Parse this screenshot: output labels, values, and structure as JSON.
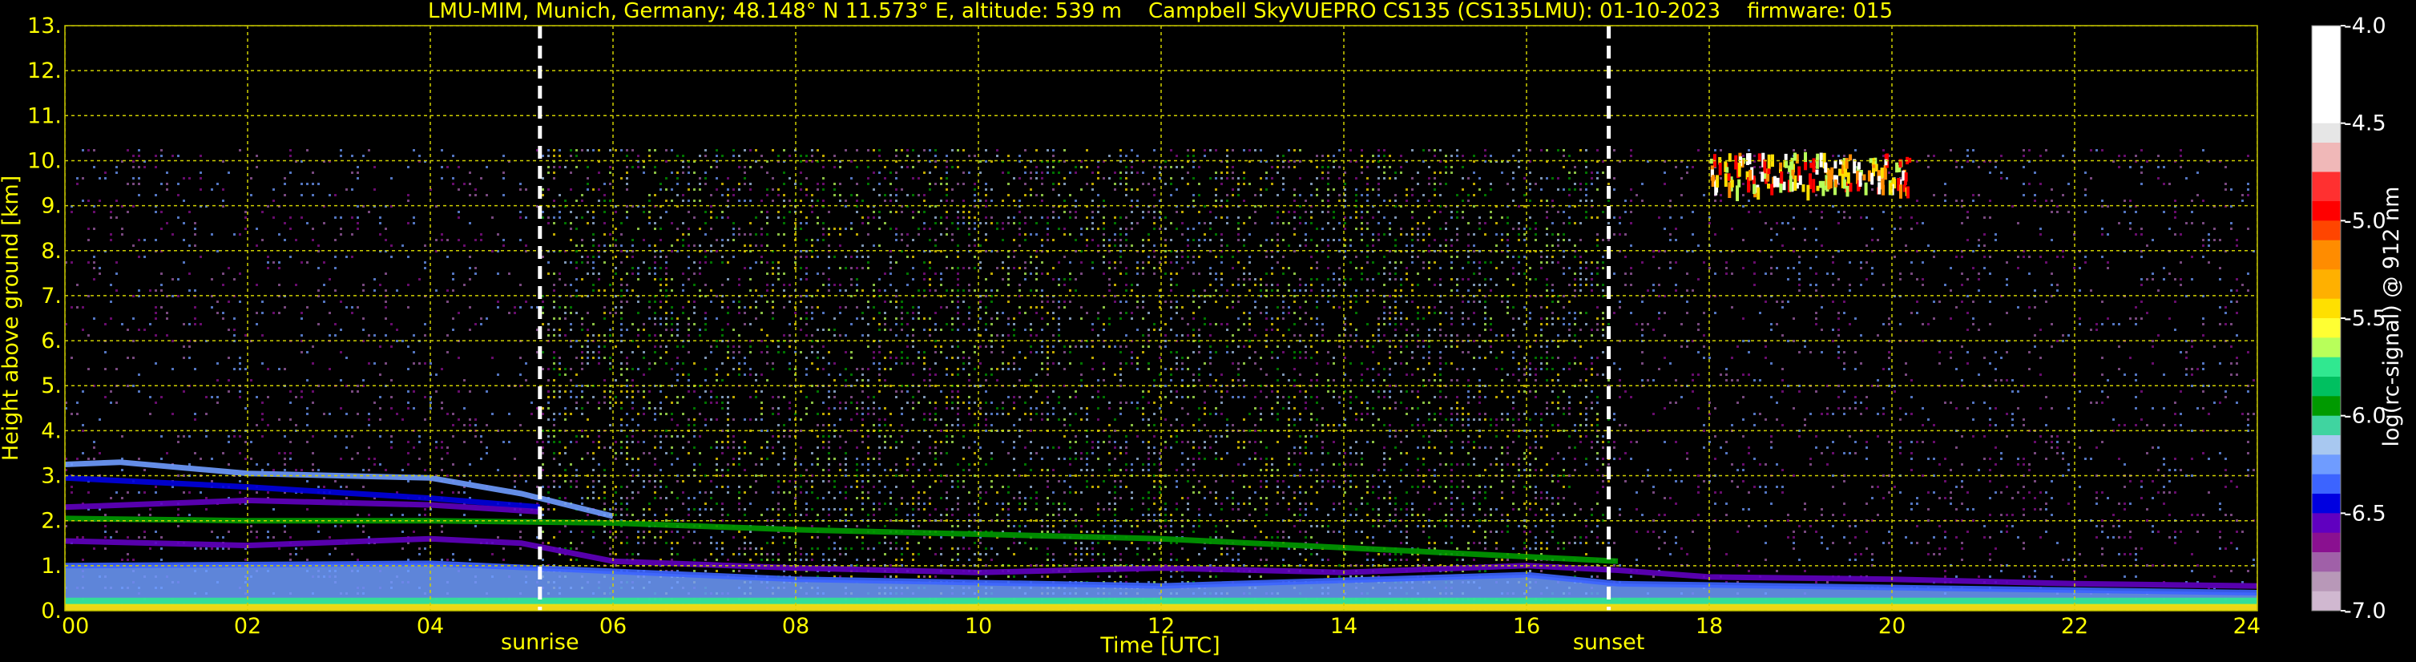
{
  "chart_data": {
    "type": "heatmap",
    "title": "LMU-MIM, Munich, Germany; 48.148° N 11.573° E, altitude: 539 m    Campbell SkyVUEPRO CS135 (CS135LMU): 01-10-2023    firmware: 015",
    "xlabel": "Time [UTC]",
    "ylabel": "Height above ground [km]",
    "xlim": [
      0,
      24
    ],
    "ylim": [
      0,
      13
    ],
    "x_ticks": [
      {
        "value": 0,
        "label": "00"
      },
      {
        "value": 2,
        "label": "02"
      },
      {
        "value": 4,
        "label": "04"
      },
      {
        "value": 6,
        "label": "06"
      },
      {
        "value": 8,
        "label": "08"
      },
      {
        "value": 10,
        "label": "10"
      },
      {
        "value": 12,
        "label": "12"
      },
      {
        "value": 14,
        "label": "14"
      },
      {
        "value": 16,
        "label": "16"
      },
      {
        "value": 18,
        "label": "18"
      },
      {
        "value": 20,
        "label": "20"
      },
      {
        "value": 22,
        "label": "22"
      },
      {
        "value": 24,
        "label": "24"
      }
    ],
    "y_ticks": [
      {
        "value": 0,
        "label": "0."
      },
      {
        "value": 1,
        "label": "1."
      },
      {
        "value": 2,
        "label": "2."
      },
      {
        "value": 3,
        "label": "3."
      },
      {
        "value": 4,
        "label": "4."
      },
      {
        "value": 5,
        "label": "5."
      },
      {
        "value": 6,
        "label": "6."
      },
      {
        "value": 7,
        "label": "7."
      },
      {
        "value": 8,
        "label": "8."
      },
      {
        "value": 9,
        "label": "9."
      },
      {
        "value": 10,
        "label": "10."
      },
      {
        "value": 11,
        "label": "11."
      },
      {
        "value": 12,
        "label": "12."
      },
      {
        "value": 13,
        "label": "13."
      }
    ],
    "grid": true,
    "annotations": [
      {
        "x": 5.2,
        "label": "sunrise"
      },
      {
        "x": 16.9,
        "label": "sunset"
      }
    ],
    "colorbar": {
      "label": "log(rc-signal) @ 912 nm",
      "range": [
        -7.0,
        -4.0
      ],
      "ticks": [
        {
          "value": -4.0,
          "label": "-4.0"
        },
        {
          "value": -4.5,
          "label": "-4.5"
        },
        {
          "value": -5.0,
          "label": "-5.0"
        },
        {
          "value": -5.5,
          "label": "-5.5"
        },
        {
          "value": -6.0,
          "label": "-6.0"
        },
        {
          "value": -6.5,
          "label": "-6.5"
        },
        {
          "value": -7.0,
          "label": "-7.0"
        }
      ],
      "levels": [
        {
          "from": -4.0,
          "to": -4.5,
          "color": "#ffffff"
        },
        {
          "from": -4.5,
          "to": -4.6,
          "color": "#e6e6e6"
        },
        {
          "from": -4.6,
          "to": -4.75,
          "color": "#f0b8b8"
        },
        {
          "from": -4.75,
          "to": -4.9,
          "color": "#ff3030"
        },
        {
          "from": -4.9,
          "to": -5.0,
          "color": "#ff0000"
        },
        {
          "from": -5.0,
          "to": -5.1,
          "color": "#ff4500"
        },
        {
          "from": -5.1,
          "to": -5.25,
          "color": "#ff8c00"
        },
        {
          "from": -5.25,
          "to": -5.4,
          "color": "#ffb000"
        },
        {
          "from": -5.4,
          "to": -5.5,
          "color": "#ffe000"
        },
        {
          "from": -5.5,
          "to": -5.6,
          "color": "#ffff33"
        },
        {
          "from": -5.6,
          "to": -5.7,
          "color": "#b8ff5a"
        },
        {
          "from": -5.7,
          "to": -5.8,
          "color": "#30e890"
        },
        {
          "from": -5.8,
          "to": -5.9,
          "color": "#00c060"
        },
        {
          "from": -5.9,
          "to": -6.0,
          "color": "#009a00"
        },
        {
          "from": -6.0,
          "to": -6.1,
          "color": "#40d4a0"
        },
        {
          "from": -6.1,
          "to": -6.2,
          "color": "#a8c8f0"
        },
        {
          "from": -6.2,
          "to": -6.3,
          "color": "#6f9cff"
        },
        {
          "from": -6.3,
          "to": -6.4,
          "color": "#3c64ff"
        },
        {
          "from": -6.4,
          "to": -6.5,
          "color": "#0000e0"
        },
        {
          "from": -6.5,
          "to": -6.6,
          "color": "#6000c0"
        },
        {
          "from": -6.6,
          "to": -6.7,
          "color": "#8a1090"
        },
        {
          "from": -6.7,
          "to": -6.8,
          "color": "#a060a8"
        },
        {
          "from": -6.8,
          "to": -6.9,
          "color": "#b898b8"
        },
        {
          "from": -6.9,
          "to": -7.0,
          "color": "#d0b8d0"
        }
      ]
    },
    "features": [
      {
        "type": "layer",
        "points": [
          [
            0,
            3.25
          ],
          [
            0.6,
            3.3
          ],
          [
            2,
            3.05
          ],
          [
            4,
            2.95
          ],
          [
            5,
            2.6
          ],
          [
            6,
            2.1
          ]
        ],
        "level": -6.3
      },
      {
        "type": "layer",
        "points": [
          [
            0,
            2.95
          ],
          [
            2,
            2.75
          ],
          [
            4,
            2.5
          ],
          [
            5.2,
            2.3
          ]
        ],
        "level": -6.5
      },
      {
        "type": "layer",
        "points": [
          [
            0,
            2.3
          ],
          [
            2,
            2.45
          ],
          [
            4,
            2.35
          ],
          [
            5.2,
            2.2
          ]
        ],
        "level": -6.6
      },
      {
        "type": "layer",
        "points": [
          [
            0,
            2.05
          ],
          [
            2,
            2.0
          ],
          [
            4,
            2.0
          ],
          [
            6,
            1.95
          ],
          [
            8,
            1.8
          ],
          [
            10,
            1.7
          ],
          [
            12,
            1.6
          ],
          [
            14,
            1.4
          ],
          [
            16,
            1.2
          ],
          [
            17,
            1.1
          ]
        ],
        "level": -6.0
      },
      {
        "type": "layer",
        "points": [
          [
            0,
            1.55
          ],
          [
            2,
            1.45
          ],
          [
            4,
            1.6
          ],
          [
            5,
            1.5
          ],
          [
            6,
            1.1
          ],
          [
            8,
            0.95
          ],
          [
            10,
            0.85
          ],
          [
            12,
            0.95
          ],
          [
            14,
            0.85
          ],
          [
            16,
            1.0
          ],
          [
            17,
            0.9
          ],
          [
            18,
            0.75
          ],
          [
            20,
            0.7
          ],
          [
            22,
            0.6
          ],
          [
            24,
            0.55
          ]
        ],
        "level": -6.6
      },
      {
        "type": "layer",
        "points": [
          [
            0,
            1.0
          ],
          [
            4,
            1.05
          ],
          [
            8,
            0.7
          ],
          [
            12,
            0.55
          ],
          [
            16,
            0.8
          ],
          [
            17,
            0.6
          ],
          [
            24,
            0.4
          ]
        ],
        "level": -6.4
      },
      {
        "type": "layer",
        "points": [
          [
            0,
            0.2
          ],
          [
            24,
            0.2
          ]
        ],
        "level": -5.8
      },
      {
        "type": "layer",
        "points": [
          [
            0,
            0.06
          ],
          [
            24,
            0.06
          ]
        ],
        "level": -5.5
      },
      {
        "type": "cloud",
        "x": [
          18,
          20.2
        ],
        "y": [
          9.4,
          10.2
        ],
        "level": -5.0
      }
    ]
  }
}
